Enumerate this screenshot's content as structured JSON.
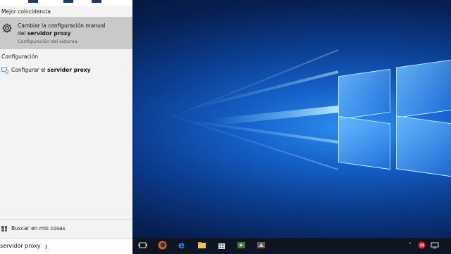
{
  "search_panel": {
    "best_match_title": "Mejor coincidencia",
    "best_match": {
      "line1": "Cambiar la configuración manual",
      "line2_prefix": "del ",
      "line2_bold": "servidor proxy",
      "subtitle": "Configuración del sistema",
      "icon": "gear-icon"
    },
    "settings_title": "Configuración",
    "settings_item": {
      "prefix": "Configurar el ",
      "bold": "servidor proxy",
      "icon": "proxy-settings-icon"
    },
    "search_mine_label": "Buscar en mis cosas",
    "search_query": "servidor proxy"
  },
  "taskbar": {
    "icons": [
      "task-view-icon",
      "firefox-icon",
      "edge-icon",
      "file-explorer-icon",
      "store-icon",
      "app-icon",
      "app-icon-2"
    ],
    "tray_icons": [
      "chevron-up-icon",
      "notification-badge-icon",
      "network-icon"
    ]
  },
  "colors": {
    "accent": "#0078d7",
    "panel_bg": "#f3f3f3",
    "highlight": "#c9c9c9",
    "taskbar": "#10141e"
  }
}
